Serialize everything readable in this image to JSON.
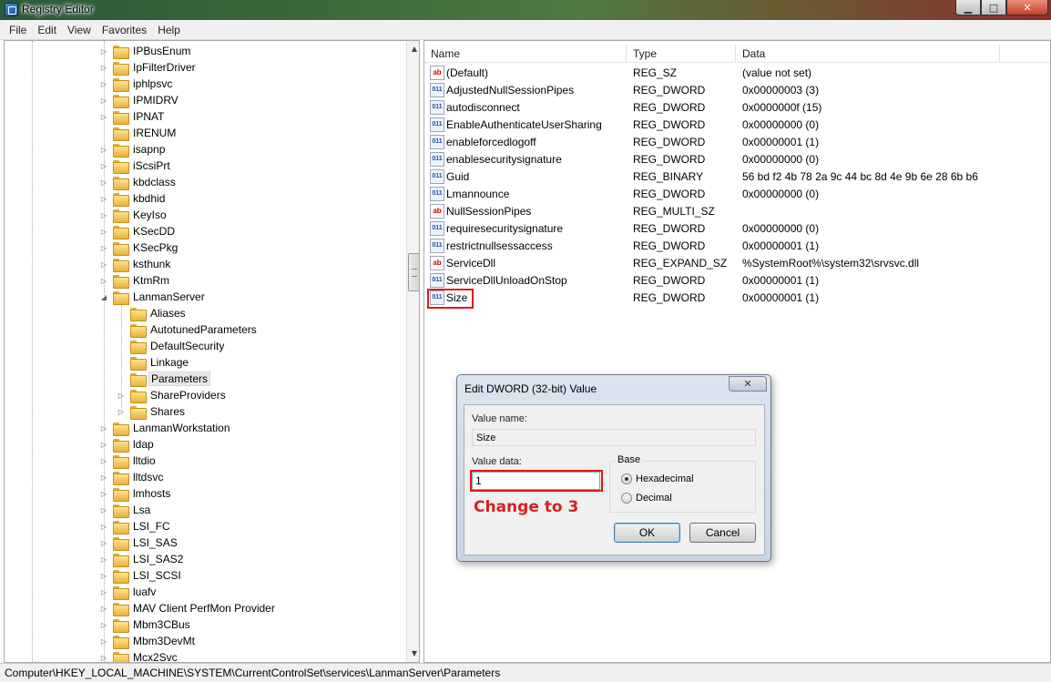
{
  "window": {
    "title": "Registry Editor"
  },
  "menu": [
    "File",
    "Edit",
    "View",
    "Favorites",
    "Help"
  ],
  "tree": {
    "items": [
      {
        "label": "IPBusEnum",
        "level": 0,
        "expander": true
      },
      {
        "label": "IpFilterDriver",
        "level": 0,
        "expander": true
      },
      {
        "label": "iphlpsvc",
        "level": 0,
        "expander": true
      },
      {
        "label": "IPMIDRV",
        "level": 0,
        "expander": true
      },
      {
        "label": "IPNAT",
        "level": 0,
        "expander": true
      },
      {
        "label": "IRENUM",
        "level": 0,
        "expander": false
      },
      {
        "label": "isapnp",
        "level": 0,
        "expander": true
      },
      {
        "label": "iScsiPrt",
        "level": 0,
        "expander": true
      },
      {
        "label": "kbdclass",
        "level": 0,
        "expander": true
      },
      {
        "label": "kbdhid",
        "level": 0,
        "expander": true
      },
      {
        "label": "KeyIso",
        "level": 0,
        "expander": true
      },
      {
        "label": "KSecDD",
        "level": 0,
        "expander": true
      },
      {
        "label": "KSecPkg",
        "level": 0,
        "expander": true
      },
      {
        "label": "ksthunk",
        "level": 0,
        "expander": true
      },
      {
        "label": "KtmRm",
        "level": 0,
        "expander": true
      },
      {
        "label": "LanmanServer",
        "level": 0,
        "expander": true,
        "expanded": true
      },
      {
        "label": "Aliases",
        "level": 1,
        "expander": false
      },
      {
        "label": "AutotunedParameters",
        "level": 1,
        "expander": false
      },
      {
        "label": "DefaultSecurity",
        "level": 1,
        "expander": false
      },
      {
        "label": "Linkage",
        "level": 1,
        "expander": false
      },
      {
        "label": "Parameters",
        "level": 1,
        "expander": false,
        "selected": true
      },
      {
        "label": "ShareProviders",
        "level": 1,
        "expander": true
      },
      {
        "label": "Shares",
        "level": 1,
        "expander": true
      },
      {
        "label": "LanmanWorkstation",
        "level": 0,
        "expander": true
      },
      {
        "label": "ldap",
        "level": 0,
        "expander": true
      },
      {
        "label": "lltdio",
        "level": 0,
        "expander": true
      },
      {
        "label": "lltdsvc",
        "level": 0,
        "expander": true
      },
      {
        "label": "lmhosts",
        "level": 0,
        "expander": true
      },
      {
        "label": "Lsa",
        "level": 0,
        "expander": true
      },
      {
        "label": "LSI_FC",
        "level": 0,
        "expander": true
      },
      {
        "label": "LSI_SAS",
        "level": 0,
        "expander": true
      },
      {
        "label": "LSI_SAS2",
        "level": 0,
        "expander": true
      },
      {
        "label": "LSI_SCSI",
        "level": 0,
        "expander": true
      },
      {
        "label": "luafv",
        "level": 0,
        "expander": true
      },
      {
        "label": "MAV Client PerfMon Provider",
        "level": 0,
        "expander": true
      },
      {
        "label": "Mbm3CBus",
        "level": 0,
        "expander": true
      },
      {
        "label": "Mbm3DevMt",
        "level": 0,
        "expander": true
      },
      {
        "label": "Mcx2Svc",
        "level": 0,
        "expander": true
      }
    ]
  },
  "values": {
    "headers": {
      "name": "Name",
      "type": "Type",
      "data": "Data"
    },
    "rows": [
      {
        "icon": "string-value-icon",
        "name": "(Default)",
        "type": "REG_SZ",
        "data": "(value not set)"
      },
      {
        "icon": "binary-value-icon",
        "name": "AdjustedNullSessionPipes",
        "type": "REG_DWORD",
        "data": "0x00000003 (3)"
      },
      {
        "icon": "binary-value-icon",
        "name": "autodisconnect",
        "type": "REG_DWORD",
        "data": "0x0000000f (15)"
      },
      {
        "icon": "binary-value-icon",
        "name": "EnableAuthenticateUserSharing",
        "type": "REG_DWORD",
        "data": "0x00000000 (0)"
      },
      {
        "icon": "binary-value-icon",
        "name": "enableforcedlogoff",
        "type": "REG_DWORD",
        "data": "0x00000001 (1)"
      },
      {
        "icon": "binary-value-icon",
        "name": "enablesecuritysignature",
        "type": "REG_DWORD",
        "data": "0x00000000 (0)"
      },
      {
        "icon": "binary-value-icon",
        "name": "Guid",
        "type": "REG_BINARY",
        "data": "56 bd f2 4b 78 2a 9c 44 bc 8d 4e 9b 6e 28 6b b6"
      },
      {
        "icon": "binary-value-icon",
        "name": "Lmannounce",
        "type": "REG_DWORD",
        "data": "0x00000000 (0)"
      },
      {
        "icon": "string-value-icon",
        "name": "NullSessionPipes",
        "type": "REG_MULTI_SZ",
        "data": ""
      },
      {
        "icon": "binary-value-icon",
        "name": "requiresecuritysignature",
        "type": "REG_DWORD",
        "data": "0x00000000 (0)"
      },
      {
        "icon": "binary-value-icon",
        "name": "restrictnullsessaccess",
        "type": "REG_DWORD",
        "data": "0x00000001 (1)"
      },
      {
        "icon": "string-value-icon",
        "name": "ServiceDll",
        "type": "REG_EXPAND_SZ",
        "data": "%SystemRoot%\\system32\\srvsvc.dll"
      },
      {
        "icon": "binary-value-icon",
        "name": "ServiceDllUnloadOnStop",
        "type": "REG_DWORD",
        "data": "0x00000001 (1)"
      },
      {
        "icon": "binary-value-icon",
        "name": "Size",
        "type": "REG_DWORD",
        "data": "0x00000001 (1)"
      }
    ]
  },
  "statusbar": {
    "path": "Computer\\HKEY_LOCAL_MACHINE\\SYSTEM\\CurrentControlSet\\services\\LanmanServer\\Parameters"
  },
  "dialog": {
    "title": "Edit DWORD (32-bit) Value",
    "close_glyph": "✕",
    "value_name_label": "Value name:",
    "value_name": "Size",
    "value_data_label": "Value data:",
    "value_data": "1",
    "base_label": "Base",
    "radio_hex": "Hexadecimal",
    "radio_dec": "Decimal",
    "ok_label": "OK",
    "cancel_label": "Cancel"
  },
  "annotation": {
    "text": "Change to 3",
    "color": "#d42020"
  },
  "colors": {
    "highlight_box": "#e01818"
  }
}
